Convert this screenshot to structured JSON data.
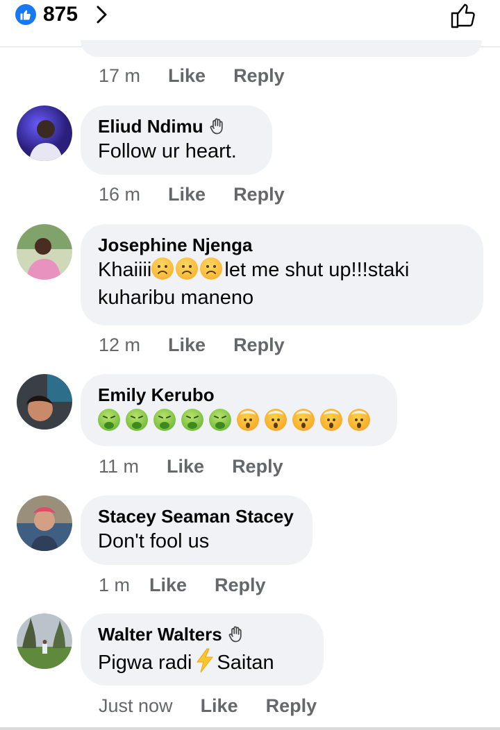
{
  "header": {
    "like_count": "875",
    "icons": {
      "reaction": "like-reaction-icon",
      "chevron": "chevron-right-icon",
      "like_button": "thumbs-up-outline-icon"
    },
    "accent": "#1877f2"
  },
  "actions": {
    "like": "Like",
    "reply": "Reply"
  },
  "previous_comment": {
    "time": "17 m"
  },
  "comments": [
    {
      "name": "Eliud Ndimu",
      "wave": true,
      "line1": "Follow ur heart.",
      "time": "16 m"
    },
    {
      "name": "Josephine Njenga",
      "wave": false,
      "line1a": "Khaiiii",
      "line1b": "let me shut up!!!staki",
      "line2": "kuharibu maneno",
      "time": "12 m"
    },
    {
      "name": "Emily Kerubo",
      "wave": false,
      "time": "11 m"
    },
    {
      "name": "Stacey Seaman Stacey",
      "wave": false,
      "line1": "Don't fool us",
      "time": "1 m"
    },
    {
      "name": "Walter Walters",
      "wave": true,
      "line1a": "Pigwa radi",
      "line1b": "Saitan",
      "time": "Just now"
    }
  ],
  "colors": {
    "bubble": "#f0f2f5",
    "meta_text": "#65676b",
    "text": "#050505"
  }
}
